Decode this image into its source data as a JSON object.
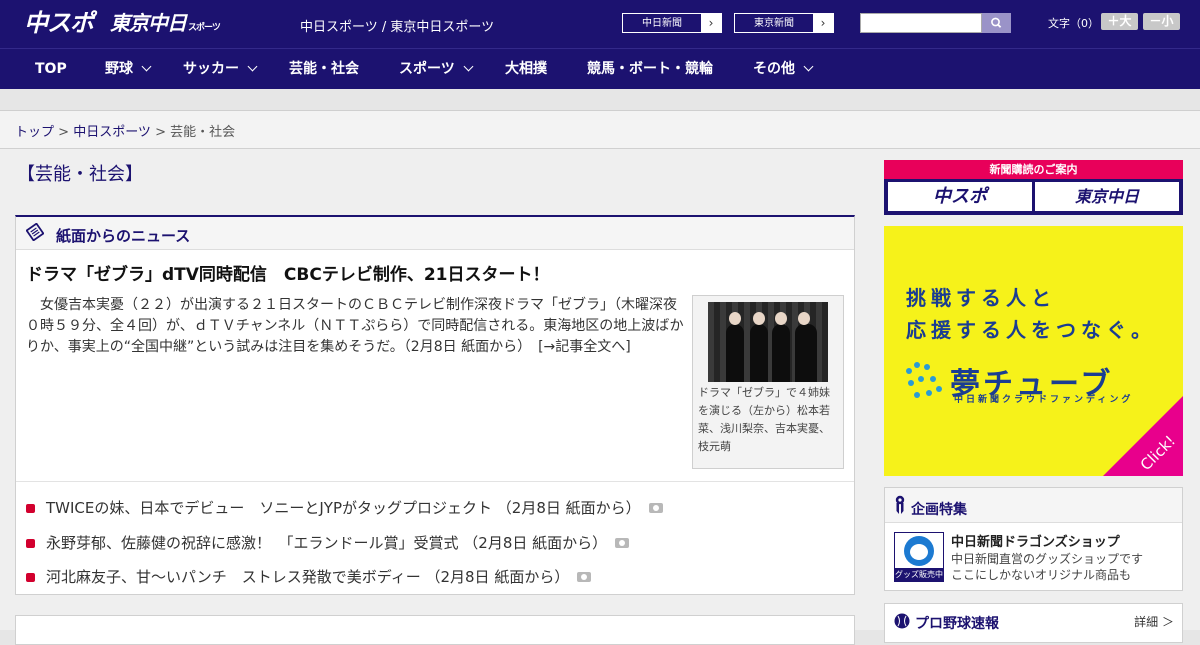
{
  "header": {
    "logo_chuspo": "中スポ",
    "logo_tokyo": "東京中日",
    "logo_tokyo_small": "スポーツ",
    "site_title": "中日スポーツ / 東京中日スポーツ",
    "paper_links": [
      {
        "label": "中日新聞"
      },
      {
        "label": "東京新聞"
      }
    ],
    "search_placeholder": "",
    "font_size_label": "文字（0）",
    "font_larger": "＋大",
    "font_smaller": "－小"
  },
  "nav": [
    {
      "label": "TOP",
      "has_menu": false
    },
    {
      "label": "野球",
      "has_menu": true
    },
    {
      "label": "サッカー",
      "has_menu": true
    },
    {
      "label": "芸能・社会",
      "has_menu": false
    },
    {
      "label": "スポーツ",
      "has_menu": true
    },
    {
      "label": "大相撲",
      "has_menu": false
    },
    {
      "label": "競馬・ボート・競輪",
      "has_menu": false
    },
    {
      "label": "その他",
      "has_menu": true
    }
  ],
  "breadcrumb": {
    "home": "トップ",
    "sep1": " > ",
    "section": "中日スポーツ",
    "sep2": " > ",
    "current": "芸能・社会"
  },
  "page_title": "【芸能・社会】",
  "news": {
    "section_title": "紙面からのニュース",
    "lead": {
      "title": "ドラマ「ゼブラ」dTV同時配信　CBCテレビ制作、21日スタート！",
      "body": "　女優吉本実憂（２２）が出演する２１日スタートのＣＢＣテレビ制作深夜ドラマ「ゼブラ」（木曜深夜０時５９分、全４回）が、ｄＴＶチャンネル（ＮＴＴぷらら）で同時配信される。東海地区の地上波ばかりか、事実上の“全国中継”という試みは注目を集めそうだ。（2月8日 紙面から）　[→記事全文へ]",
      "photo_caption": "ドラマ「ゼブラ」で４姉妹を演じる（左から）松本若菜、浅川梨奈、吉本実憂、枝元萌"
    },
    "items": [
      {
        "title": "TWICEの妹、日本でデビュー　ソニーとJYPがタッグプロジェクト （2月8日 紙面から）"
      },
      {
        "title": "永野芽郁、佐藤健の祝辞に感激！　「エランドール賞」受賞式 （2月8日 紙面から）"
      },
      {
        "title": "河北麻友子、甘～いパンチ　ストレス発散で美ボディー （2月8日 紙面から）"
      }
    ]
  },
  "sidebar": {
    "subscribe_banner": "新聞購読のご案内",
    "subscribe_chuspo": "中スポ",
    "subscribe_tokyo": "東京中日",
    "ad_line1": "挑戦する人と",
    "ad_line2": "応援する人をつなぐ。",
    "ad_logo": "夢チューブ",
    "ad_sub": "中日新聞クラウドファンディング",
    "ad_click": "Click!",
    "feature_title": "企画特集",
    "shop_label": "グッズ販売中",
    "shop_title": "中日新聞ドラゴンズショップ",
    "shop_desc1": "中日新聞直営のグッズショップです",
    "shop_desc2": "ここにしかないオリジナル商品も",
    "baseball_title": "プロ野球速報",
    "baseball_more": "詳細 ＞"
  }
}
